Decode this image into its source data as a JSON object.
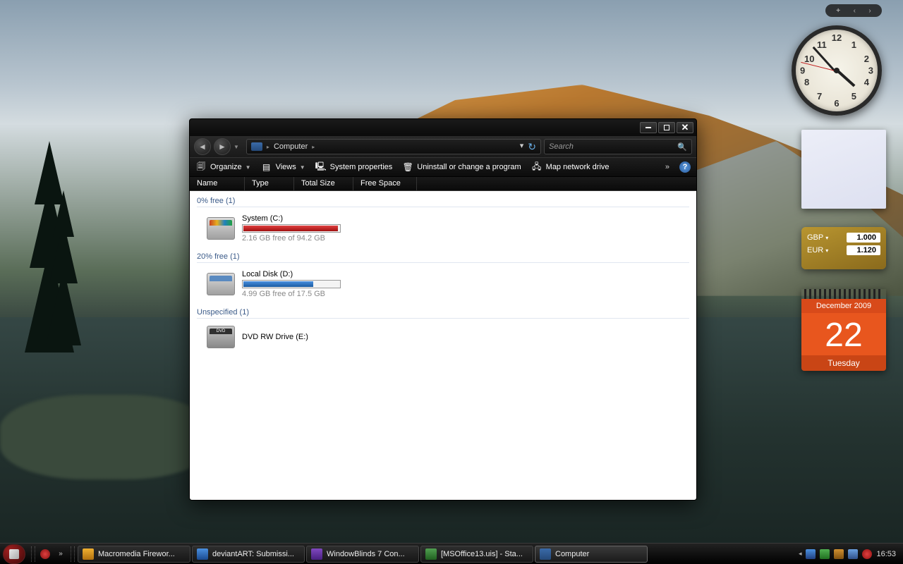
{
  "window": {
    "breadcrumb": "Computer",
    "search_placeholder": "Search",
    "toolbar": {
      "organize": "Organize",
      "views": "Views",
      "system_properties": "System properties",
      "uninstall": "Uninstall or change a program",
      "map_drive": "Map network drive",
      "more": "»"
    },
    "headers": {
      "name": "Name",
      "type": "Type",
      "total_size": "Total Size",
      "free_space": "Free Space"
    },
    "groups": [
      {
        "label": "0% free (1)",
        "drives": [
          {
            "name": "System (C:)",
            "stats": "2.16 GB free of 94.2 GB",
            "bar": "red",
            "icon": "sys"
          }
        ]
      },
      {
        "label": "20% free (1)",
        "drives": [
          {
            "name": "Local Disk (D:)",
            "stats": "4.99 GB free of 17.5 GB",
            "bar": "blue",
            "icon": "hdd"
          }
        ]
      },
      {
        "label": "Unspecified (1)",
        "drives": [
          {
            "name": "DVD RW Drive (E:)",
            "stats": "",
            "bar": "",
            "icon": "dvd"
          }
        ]
      }
    ]
  },
  "gadgets": {
    "currency": {
      "row1_label": "GBP",
      "row1_value": "1.000",
      "row2_label": "EUR",
      "row2_value": "1.120"
    },
    "calendar": {
      "month_year": "December 2009",
      "day": "22",
      "dow": "Tuesday"
    }
  },
  "taskbar": {
    "items": [
      {
        "label": "Macromedia Firewor...",
        "color": "linear-gradient(#f0b030,#b07010)"
      },
      {
        "label": "deviantART: Submissi...",
        "color": "linear-gradient(#4a90e0,#1a4a90)"
      },
      {
        "label": "WindowBlinds 7 Con...",
        "color": "linear-gradient(#8048c0,#482080)"
      },
      {
        "label": "[MSOffice13.uis] - Sta...",
        "color": "linear-gradient(#50a050,#206020)"
      },
      {
        "label": "Computer",
        "color": "linear-gradient(#3a6aa8,#254a7a)"
      }
    ],
    "clock": "16:53"
  }
}
